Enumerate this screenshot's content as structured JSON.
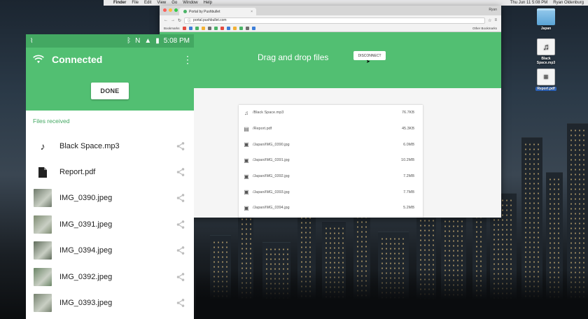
{
  "mac": {
    "menubar": {
      "apple_glyph": "",
      "items": [
        "Finder",
        "File",
        "Edit",
        "View",
        "Go",
        "Window",
        "Help"
      ],
      "clock": "Thu Jun 11  5:08 PM",
      "user": "Ryan Oldenburg"
    },
    "desktop_icons": [
      {
        "label": "Japan",
        "icon": "folder-icon"
      },
      {
        "label": "Black Space.mp3",
        "icon": "audio-file-icon"
      },
      {
        "label": "Report.pdf",
        "icon": "pdf-file-icon"
      }
    ]
  },
  "browser": {
    "tab_title": "Portal by Pushbullet",
    "tab_close": "×",
    "profile": "Ryan",
    "url": "portal.pushbullet.com",
    "bookmarks_label": "Bookmarks",
    "other_bookmarks": "Other Bookmarks",
    "bookmark_colors": [
      "#e34b3f",
      "#3b7dd8",
      "#4ab367",
      "#f2b134",
      "#6e6e6e",
      "#4ab367",
      "#e34b3f",
      "#3b7dd8",
      "#f2b134",
      "#4ab367",
      "#6e6e6e",
      "#3b7dd8"
    ],
    "traffic_lights": [
      "#fc605b",
      "#fdbc40",
      "#34c84a"
    ]
  },
  "portal": {
    "header_text": "Drag and drop files",
    "disconnect_label": "DISCONNECT",
    "accent_color": "#52bf72",
    "files": [
      {
        "icon": "music-icon",
        "name": "/Black Space.mp3",
        "size": "76.7KB"
      },
      {
        "icon": "document-icon",
        "name": "/Report.pdf",
        "size": "45.3KB"
      },
      {
        "icon": "image-icon",
        "name": "/Japan/IMG_0390.jpg",
        "size": "6.0MB"
      },
      {
        "icon": "image-icon",
        "name": "/Japan/IMG_0391.jpg",
        "size": "10.2MB"
      },
      {
        "icon": "image-icon",
        "name": "/Japan/IMG_0392.jpg",
        "size": "7.2MB"
      },
      {
        "icon": "image-icon",
        "name": "/Japan/IMG_0393.jpg",
        "size": "7.7MB"
      },
      {
        "icon": "image-icon",
        "name": "/Japan/IMG_0394.jpg",
        "size": "5.2MB"
      }
    ]
  },
  "phone": {
    "status_time": "5:08 PM",
    "status_bar_color": "#43a862",
    "title": "Connected",
    "done_label": "DONE",
    "section_label": "Files received",
    "files": [
      {
        "name": "Black Space.mp3",
        "kind": "music-icon"
      },
      {
        "name": "Report.pdf",
        "kind": "document-icon"
      },
      {
        "name": "IMG_0390.jpeg",
        "kind": "thumbnail",
        "thumb_color": "#6f7a6b"
      },
      {
        "name": "IMG_0391.jpeg",
        "kind": "thumbnail",
        "thumb_color": "#7e8c72"
      },
      {
        "name": "IMG_0394.jpeg",
        "kind": "thumbnail",
        "thumb_color": "#5f6b5a"
      },
      {
        "name": "IMG_0392.jpeg",
        "kind": "thumbnail",
        "thumb_color": "#6a8566"
      },
      {
        "name": "IMG_0393.jpeg",
        "kind": "thumbnail",
        "thumb_color": "#75816e"
      }
    ]
  }
}
